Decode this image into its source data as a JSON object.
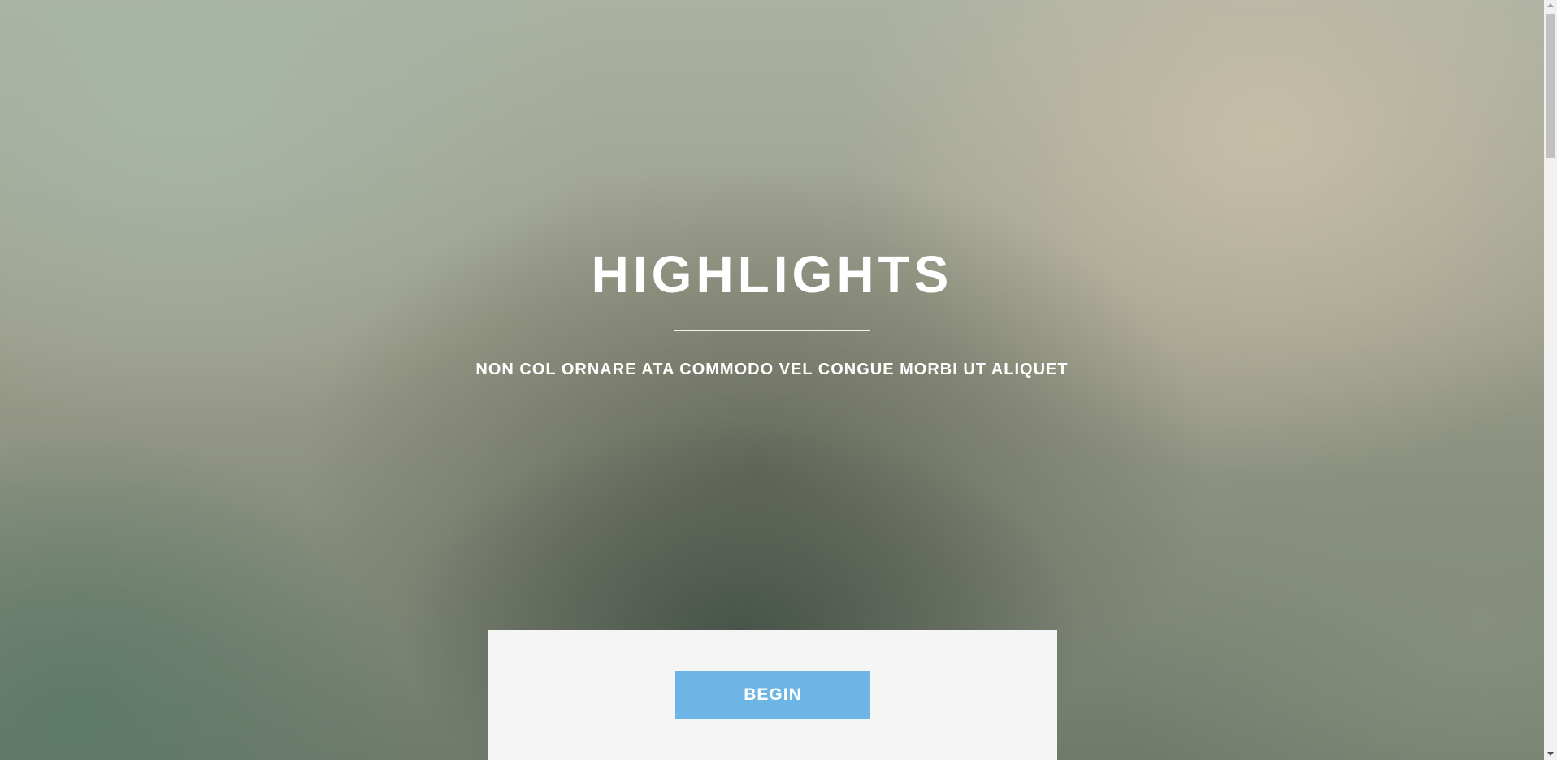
{
  "hero": {
    "title": "HIGHLIGHTS",
    "subtitle": "NON COL ORNARE ATA COMMODO VEL CONGUE MORBI UT ALIQUET"
  },
  "cta": {
    "begin_label": "BEGIN"
  },
  "colors": {
    "button": "#6db5e4",
    "panel": "#f5f5f5",
    "text": "#ffffff"
  }
}
